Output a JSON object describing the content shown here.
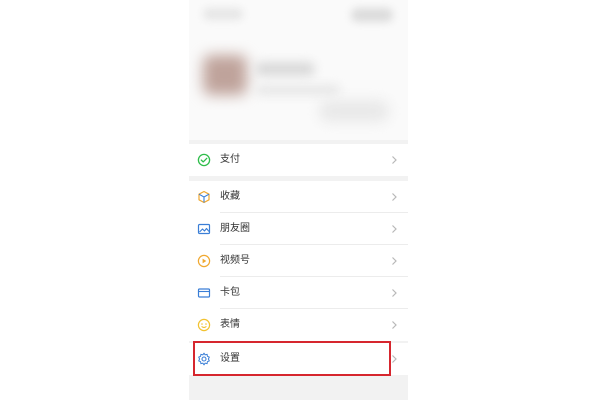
{
  "menu": {
    "pay": {
      "label": "支付",
      "icon": "wechat-pay-icon",
      "color": "#2ebd4a"
    },
    "favorites": {
      "label": "收藏",
      "icon": "cube-icon",
      "color": "#f0a830"
    },
    "moments": {
      "label": "朋友圈",
      "icon": "image-icon",
      "color": "#3a7ed6"
    },
    "channels": {
      "label": "视频号",
      "icon": "play-circle-icon",
      "color": "#f0a830"
    },
    "cards": {
      "label": "卡包",
      "icon": "card-icon",
      "color": "#3a7ed6"
    },
    "stickers": {
      "label": "表情",
      "icon": "smiley-icon",
      "color": "#f2c230"
    },
    "settings": {
      "label": "设置",
      "icon": "gear-icon",
      "color": "#3a7ed6"
    }
  },
  "colors": {
    "highlight": "#d6262e",
    "background": "#f2f2f2",
    "chevron": "#b8b8b8"
  }
}
